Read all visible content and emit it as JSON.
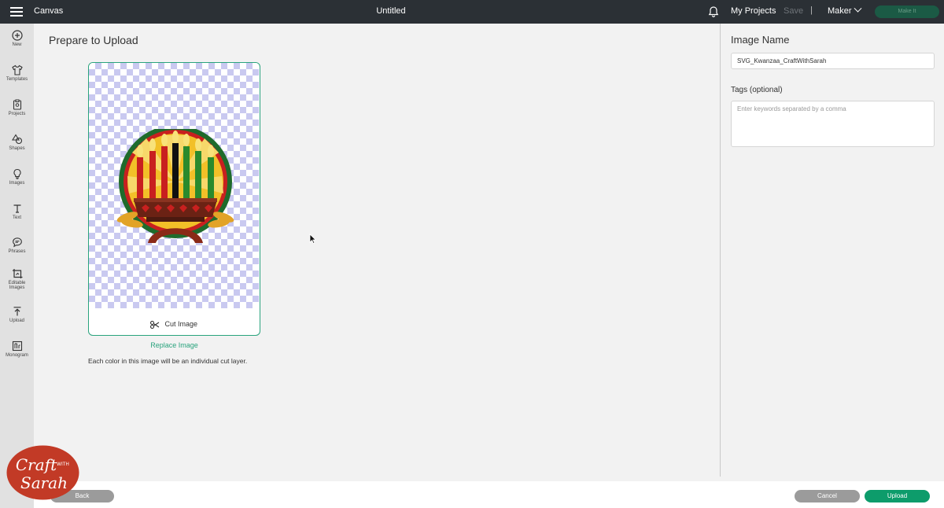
{
  "topbar": {
    "app_name": "Canvas",
    "doc_title": "Untitled",
    "my_projects": "My Projects",
    "save": "Save",
    "separator": "|",
    "machine": "Maker",
    "make_it": "Make It"
  },
  "sidebar": {
    "items": [
      {
        "label": "New",
        "icon": "plus-circle-icon"
      },
      {
        "label": "Templates",
        "icon": "shirt-icon"
      },
      {
        "label": "Projects",
        "icon": "clipboard-icon"
      },
      {
        "label": "Shapes",
        "icon": "shapes-icon"
      },
      {
        "label": "Images",
        "icon": "lightbulb-icon"
      },
      {
        "label": "Text",
        "icon": "text-icon"
      },
      {
        "label": "Phrases",
        "icon": "speech-bubble-icon"
      },
      {
        "label": "Editable",
        "label2": "Images",
        "icon": "editable-image-icon"
      },
      {
        "label": "Upload",
        "icon": "upload-icon"
      },
      {
        "label": "Monogram",
        "icon": "monogram-icon"
      }
    ]
  },
  "main": {
    "title": "Prepare to Upload",
    "cut_image_label": "Cut Image",
    "replace_link": "Replace Image",
    "help_text": "Each color in this image will be an individual cut layer."
  },
  "right_panel": {
    "image_name_label": "Image Name",
    "image_name_value": "SVG_Kwanzaa_CraftWithSarah",
    "tags_label": "Tags (optional)",
    "tags_placeholder": "Enter keywords separated by a comma"
  },
  "bottom": {
    "back": "Back",
    "cancel": "Cancel",
    "upload": "Upload"
  },
  "watermark": {
    "line1": "Craft",
    "line2": "WITH",
    "line3": "Sarah"
  },
  "colors": {
    "accent": "#2aa37d",
    "upload_button": "#0d9c6b",
    "topbar": "#2b3035"
  }
}
